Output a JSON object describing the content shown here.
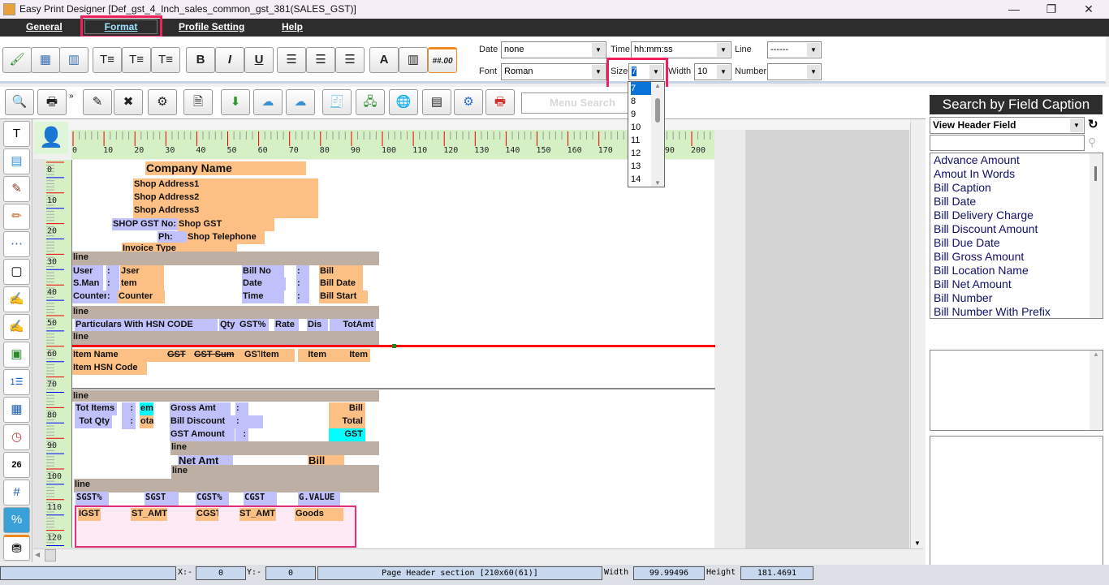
{
  "window": {
    "title": "Easy Print Designer [Def_gst_4_Inch_sales_common_gst_381(SALES_GST)]",
    "minimize": "—",
    "maximize": "❐",
    "close": "✕"
  },
  "menu": [
    "General",
    "Format",
    "Profile Setting",
    "Help"
  ],
  "format": {
    "date_label": "Date",
    "date_value": "none",
    "time_label": "Time",
    "time_value": "hh:mm:ss",
    "line_label": "Line",
    "line_value": "------",
    "font_label": "Font",
    "font_value": "Roman",
    "size_label": "Size",
    "size_value": "7",
    "width_label": "Width",
    "width_value": "10",
    "number_label": "Number",
    "number_value": "",
    "size_options": [
      "7",
      "8",
      "9",
      "10",
      "11",
      "12",
      "13",
      "14"
    ]
  },
  "toolbar_format_icons": [
    "paint-brush",
    "insert-row",
    "insert-column",
    "text-align-left",
    "text-align-center",
    "text-align-right",
    "B",
    "I",
    "U",
    "align-left",
    "align-center",
    "align-right",
    "font-color",
    "barcode",
    "##.00"
  ],
  "menu_search_placeholder": "Menu Search",
  "ruler": {
    "top": [
      "0",
      "10",
      "20",
      "30",
      "40",
      "50",
      "60",
      "70",
      "80",
      "90",
      "100",
      "110",
      "120",
      "130",
      "140",
      "150",
      "160",
      "170",
      "180",
      "190",
      "200"
    ],
    "left": [
      "0",
      "10",
      "20",
      "30",
      "40",
      "50",
      "60",
      "70",
      "80",
      "90",
      "100",
      "110",
      "120"
    ]
  },
  "canvas": {
    "fields": [
      "Company Name",
      "Shop Address1",
      "Shop Address2",
      "Shop Address3",
      "SHOP GST No:",
      "Shop GST",
      "Ph:",
      "Shop Telephone",
      "Invoice Type",
      "line",
      "User",
      ":",
      "Jser",
      "S.Man",
      ":",
      "tem",
      "Counter",
      ":",
      "Counter",
      "Bill No",
      ":",
      "Bill",
      "Date",
      ":",
      "Bill Date",
      "Time",
      ":",
      "Bill Start",
      "line",
      "Particulars With HSN CODE",
      "Qty",
      "GST%",
      "Rate",
      "Dis",
      "TotAmt",
      "line",
      "Item Name",
      "GST",
      "GST  Sum",
      "GST",
      "Item",
      "Item",
      "Item",
      "Item HSN Code",
      "line",
      "Tot Items",
      ":",
      "em",
      "Tot Qty",
      ":",
      "otal",
      "Gross Amt",
      ":",
      "Bill Discount",
      ":",
      "GST Amount",
      ":",
      "Bill",
      "Total",
      "GST",
      "line",
      "Net Amt",
      "Bill",
      "line",
      "line",
      "SGST%",
      "SGST",
      "CGST%",
      "CGST",
      "G.VALUE",
      "IGST",
      "ST_AMT",
      "CGST",
      "ST_AMT",
      "Goods"
    ]
  },
  "right_panel": {
    "title": "Search by Field Caption",
    "view_select": "View Header Field",
    "fields": [
      "Advance Amount",
      "Amout In Words",
      "Bill Caption",
      "Bill Date",
      "Bill Delivery Charge",
      "Bill Discount Amount",
      "Bill Due Date",
      "Bill Gross Amount",
      "Bill Location Name",
      "Bill Net Amount",
      "Bill Number",
      "Bill Number With Prefix"
    ]
  },
  "status": {
    "x_label": "X:-",
    "x": "0",
    "y_label": "Y:-",
    "y": "0",
    "section": "Page Header section [210x60(61)]",
    "width_label": "Width",
    "width": "99.99496",
    "height_label": "Height",
    "height": "181.4691"
  }
}
